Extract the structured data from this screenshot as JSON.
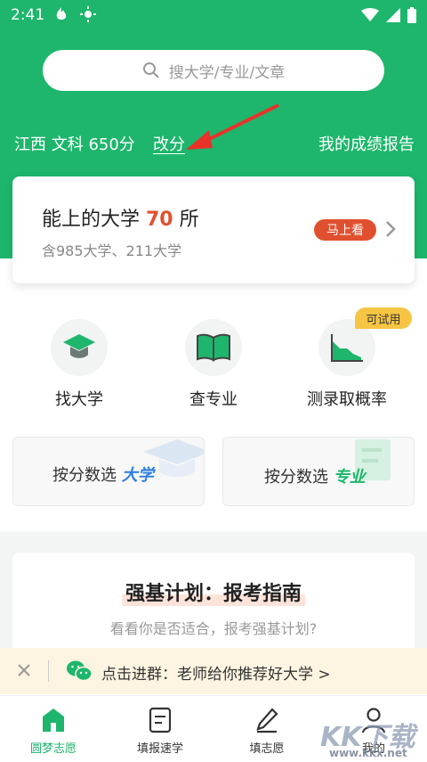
{
  "status_bar": {
    "time": "2:41"
  },
  "search": {
    "placeholder": "搜大学/专业/文章"
  },
  "score": {
    "summary": "江西 文科 650分",
    "change_label": "改分",
    "report_label": "我的成绩报告"
  },
  "uni_card": {
    "title_prefix": "能上的大学 ",
    "count": "70",
    "title_suffix": " 所",
    "subtitle": "含985大学、211大学",
    "button_label": "马上看"
  },
  "features": [
    {
      "label": "找大学",
      "icon": "graduation-cap-icon"
    },
    {
      "label": "查专业",
      "icon": "open-book-icon"
    },
    {
      "label": "测录取概率",
      "icon": "area-chart-icon"
    }
  ],
  "trial_badge": "可试用",
  "filters": [
    {
      "prefix": "按分数选 ",
      "accent": "大学",
      "color": "#2a7de1"
    },
    {
      "prefix": "按分数选 ",
      "accent": "专业",
      "color": "#1db66c"
    }
  ],
  "guide": {
    "title": "强基计划：报考指南",
    "subtitle": "看看你是否适合，报考强基计划?"
  },
  "notice": {
    "text": "点击进群：老师给你推荐好大学 >"
  },
  "tabs": [
    {
      "label": "圆梦志愿",
      "icon": "home-icon",
      "active": true
    },
    {
      "label": "填报速学",
      "icon": "document-icon",
      "active": false
    },
    {
      "label": "填志愿",
      "icon": "pen-icon",
      "active": false
    },
    {
      "label": "我的",
      "icon": "user-icon",
      "active": false
    }
  ],
  "watermark": {
    "text": "KK下载",
    "url": "www.kkx.net"
  },
  "colors": {
    "brand_green": "#1db66c",
    "accent_red": "#e0502f",
    "badge_yellow": "#f6c543"
  }
}
